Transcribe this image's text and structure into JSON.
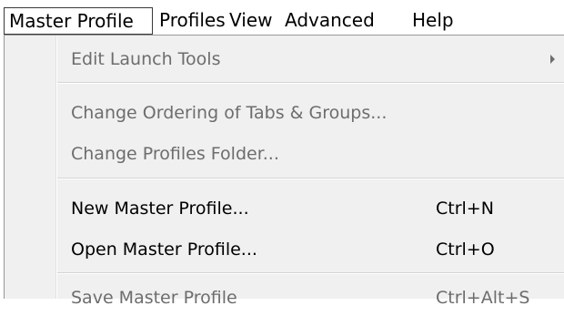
{
  "menubar": {
    "items": [
      {
        "label": "Master Profile"
      },
      {
        "label": "Profiles"
      },
      {
        "label": "View"
      },
      {
        "label": "Advanced"
      },
      {
        "label": "Help"
      }
    ]
  },
  "menu": {
    "items": [
      {
        "label": "Edit Launch Tools",
        "shortcut": "",
        "enabled": false,
        "submenu": true
      },
      {
        "label": "Change Ordering of Tabs & Groups...",
        "shortcut": "",
        "enabled": false
      },
      {
        "label": "Change Profiles Folder...",
        "shortcut": "",
        "enabled": false
      },
      {
        "label": "New Master Profile...",
        "shortcut": "Ctrl+N",
        "enabled": true
      },
      {
        "label": "Open Master Profile...",
        "shortcut": "Ctrl+O",
        "enabled": true
      },
      {
        "label": "Save Master Profile",
        "shortcut": "Ctrl+Alt+S",
        "enabled": false
      }
    ]
  },
  "colors": {
    "menu_background": "#f0f0f0",
    "disabled_text": "#6d6d6d",
    "enabled_text": "#000000"
  }
}
